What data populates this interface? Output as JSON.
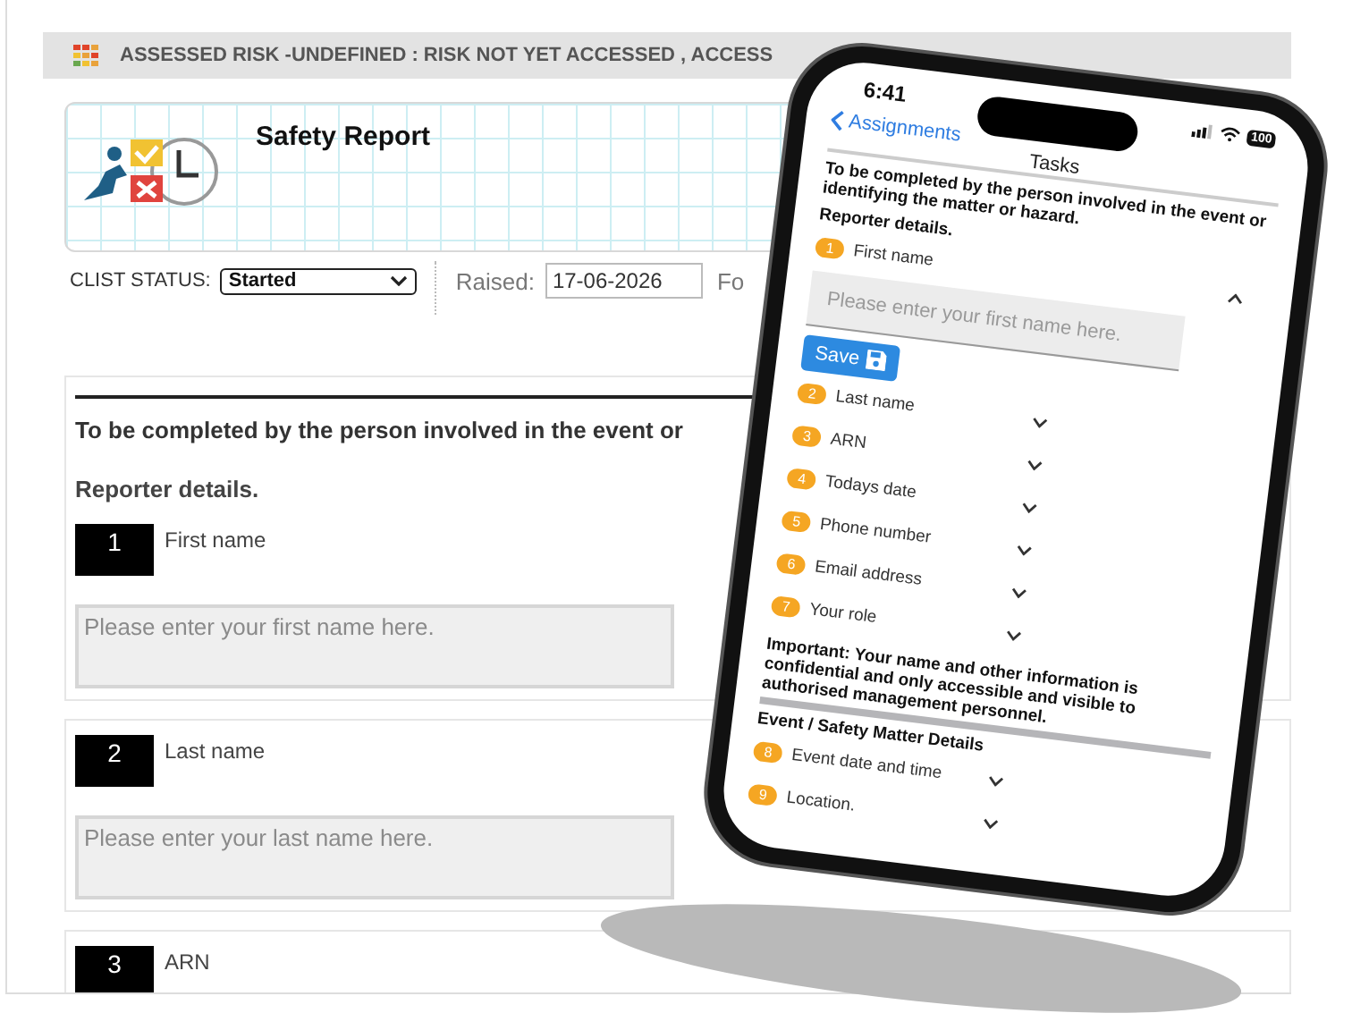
{
  "banner": {
    "text": "ASSESSED RISK -UNDEFINED : RISK NOT YET ACCESSED , ACCESS"
  },
  "report": {
    "title": "Safety Report"
  },
  "status_bar": {
    "status_label": "CLIST STATUS:",
    "status_value": "Started",
    "raised_label": "Raised:",
    "raised_value": "17-06-2026",
    "column_3": "Fo"
  },
  "form": {
    "intro": "To be completed by the person involved in the event or",
    "section": "Reporter details.",
    "questions": [
      {
        "number": "1",
        "label": "First name",
        "placeholder": "Please enter your first name here."
      },
      {
        "number": "2",
        "label": "Last name",
        "placeholder": "Please enter your last name here."
      },
      {
        "number": "3",
        "label": "ARN"
      }
    ]
  },
  "phone": {
    "time": "6:41",
    "battery": "100",
    "back": "Assignments",
    "title": "Tasks",
    "intro": "To be completed by the person involved in the event or identifying the matter or hazard.",
    "blocks": [
      {
        "kind": "heading",
        "text": "Reporter details."
      },
      {
        "kind": "question",
        "number": "1",
        "label": "First name",
        "expanded": true,
        "placeholder": "Please enter your first name here.",
        "save": "Save"
      },
      {
        "kind": "question",
        "number": "2",
        "label": "Last name",
        "expanded": false
      },
      {
        "kind": "question",
        "number": "3",
        "label": "ARN",
        "expanded": false
      },
      {
        "kind": "question",
        "number": "4",
        "label": "Todays date",
        "expanded": false
      },
      {
        "kind": "question",
        "number": "5",
        "label": "Phone number",
        "expanded": false
      },
      {
        "kind": "question",
        "number": "6",
        "label": "Email address",
        "expanded": false
      },
      {
        "kind": "question",
        "number": "7",
        "label": "Your role",
        "expanded": false
      },
      {
        "kind": "notice",
        "text": "Important: Your name and other information is confidential and only accessible and visible to authorised management personnel."
      },
      {
        "kind": "heading",
        "text": "Event / Safety Matter Details"
      },
      {
        "kind": "question",
        "number": "8",
        "label": "Event date and time",
        "expanded": false
      },
      {
        "kind": "question",
        "number": "9",
        "label": "Location.",
        "expanded": false
      }
    ]
  }
}
